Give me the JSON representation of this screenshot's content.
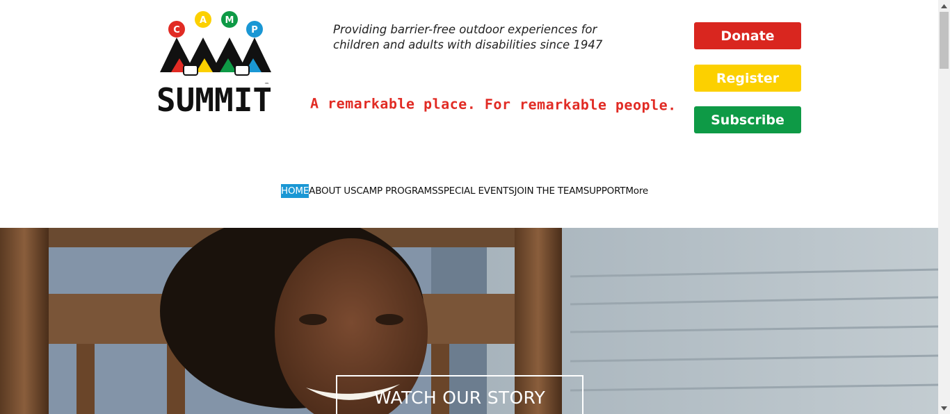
{
  "logo": {
    "circles": [
      "C",
      "A",
      "M",
      "P"
    ],
    "wordmark": "SUMMIT",
    "trademark": "™"
  },
  "header": {
    "tagline": "Providing barrier-free outdoor experiences for children and adults with disabilities since 1947",
    "slogan": "A remarkable place. For remarkable people."
  },
  "cta": {
    "donate": "Donate",
    "register": "Register",
    "subscribe": "Subscribe"
  },
  "nav": {
    "items": [
      "HOME",
      "ABOUT US",
      "CAMP PROGRAMS",
      "SPECIAL EVENTS",
      "JOIN THE TEAM",
      "SUPPORT",
      "More"
    ],
    "active_index": 0
  },
  "hero": {
    "button": "WATCH OUR STORY"
  },
  "colors": {
    "red": "#d9261f",
    "yellow": "#fcd000",
    "green": "#0e9a46",
    "blue": "#1a97d4",
    "slogan": "#e12b24"
  },
  "icons": [
    "scroll-up-arrow-icon",
    "scroll-down-arrow-icon"
  ]
}
